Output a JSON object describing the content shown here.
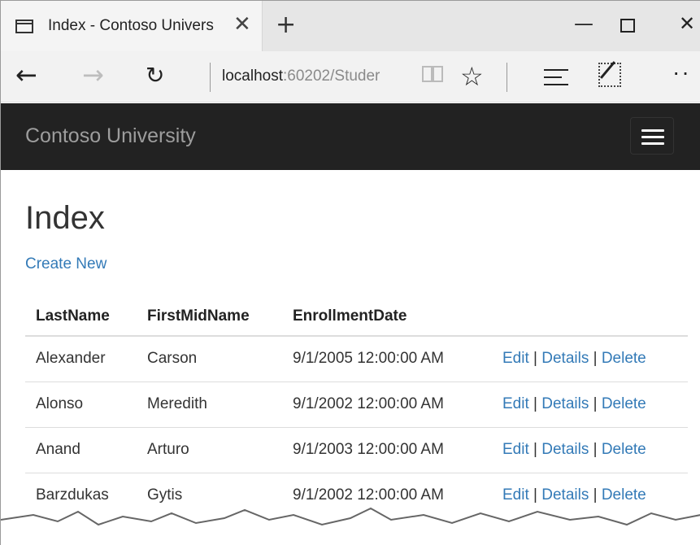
{
  "browser": {
    "tab_title": "Index - Contoso Univers",
    "tab_close": "✕",
    "new_tab": "+",
    "minimize": "—",
    "close": "✕",
    "back": "←",
    "forward": "→",
    "refresh": "↻",
    "url_host": "localhost",
    "url_rest": ":60202/Studer",
    "read": "📖",
    "favorite": "☆",
    "more": "··"
  },
  "navbar": {
    "brand": "Contoso University"
  },
  "main": {
    "title": "Index",
    "create_link": "Create New",
    "table": {
      "headers": [
        "LastName",
        "FirstMidName",
        "EnrollmentDate",
        ""
      ],
      "rows": [
        {
          "last": "Alexander",
          "first": "Carson",
          "date": "9/1/2005 12:00:00 AM"
        },
        {
          "last": "Alonso",
          "first": "Meredith",
          "date": "9/1/2002 12:00:00 AM"
        },
        {
          "last": "Anand",
          "first": "Arturo",
          "date": "9/1/2003 12:00:00 AM"
        },
        {
          "last": "Barzdukas",
          "first": "Gytis",
          "date": "9/1/2002 12:00:00 AM"
        }
      ],
      "actions": {
        "edit": "Edit",
        "details": "Details",
        "delete": "Delete",
        "separator": "|"
      }
    }
  },
  "colors": {
    "navbar_bg": "#222222",
    "brand_text": "#9d9d9d",
    "link": "#337ab7"
  }
}
